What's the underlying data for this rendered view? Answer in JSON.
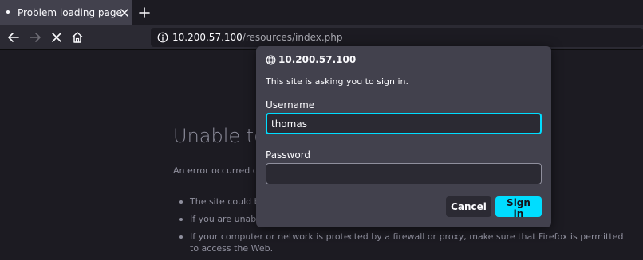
{
  "browser": {
    "tab": {
      "title": "Problem loading page"
    },
    "url": {
      "host": "10.200.57.100",
      "path": "/resources/index.php"
    }
  },
  "page": {
    "title": "Unable to",
    "description": "An error occurred dur",
    "bullets": [
      "The site could be",
      "If you are unable",
      "If your computer or network is protected by a firewall or proxy, make sure that Firefox is permitted to access the Web."
    ]
  },
  "dialog": {
    "host": "10.200.57.100",
    "message": "This site is asking you to sign in.",
    "username_label": "Username",
    "username_value": "thomas",
    "password_label": "Password",
    "password_value": "",
    "cancel_label": "Cancel",
    "signin_label": "Sign in"
  },
  "colors": {
    "accent": "#00ddff",
    "dialog_bg": "#42414d",
    "page_bg": "#1c1b22"
  },
  "icons": {
    "tab_favicon": "dot-icon",
    "tab_close": "close-icon",
    "new_tab": "plus-icon",
    "back": "arrow-left-icon",
    "forward": "arrow-right-icon",
    "stop": "stop-icon",
    "home": "home-icon",
    "site_info": "info-icon",
    "dialog_site": "globe-icon"
  }
}
